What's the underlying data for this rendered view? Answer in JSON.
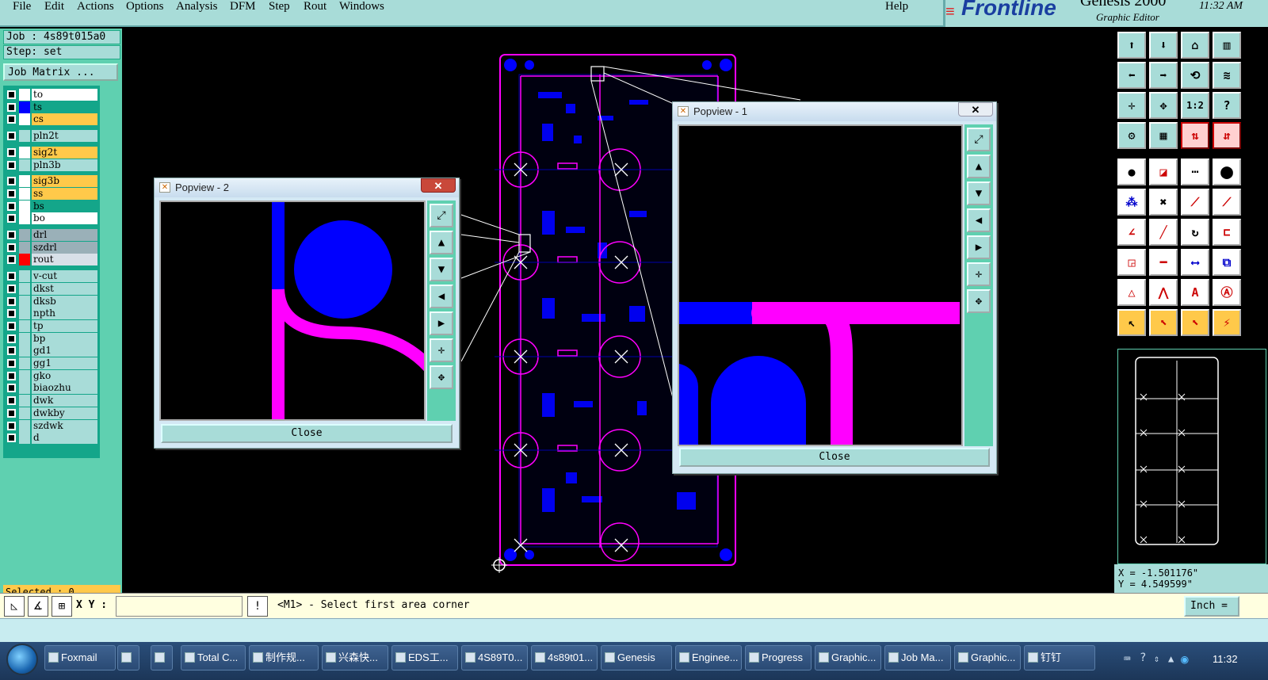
{
  "menu": {
    "items": [
      "File",
      "Edit",
      "Actions",
      "Options",
      "Analysis",
      "DFM",
      "Step",
      "Rout",
      "Windows"
    ],
    "help": "Help"
  },
  "brand": {
    "logo": "Frontline",
    "product": "Genesis 2000",
    "subtitle": "Graphic Editor",
    "time": "11:32 AM"
  },
  "job": {
    "job_line": "Job : 4s89t015a0",
    "step_line": "Step: set",
    "matrix_button": "Job Matrix ..."
  },
  "layers": [
    {
      "name": "to",
      "swatch": "#ffffff",
      "bg": "#ffffff"
    },
    {
      "name": "ts",
      "swatch": "#0000ff",
      "bg": "#14a68a"
    },
    {
      "name": "cs",
      "swatch": "#ffffff",
      "bg": "#ffc94a"
    },
    {
      "name": "pln2t",
      "swatch": "#a8dcd8",
      "bg": "#a8dcd8"
    },
    {
      "name": "sig2t",
      "swatch": "#ffffff",
      "bg": "#ffc94a"
    },
    {
      "name": "pln3b",
      "swatch": "#a8dcd8",
      "bg": "#a8dcd8"
    },
    {
      "name": "sig3b",
      "swatch": "#ffffff",
      "bg": "#ffc94a"
    },
    {
      "name": "ss",
      "swatch": "#ffffff",
      "bg": "#ffc94a"
    },
    {
      "name": "bs",
      "swatch": "#ffffff",
      "bg": "#14a68a"
    },
    {
      "name": "bo",
      "swatch": "#ffffff",
      "bg": "#ffffff"
    },
    {
      "name": "drl",
      "swatch": "#9ab0b8",
      "bg": "#9ab0b8"
    },
    {
      "name": "szdrl",
      "swatch": "#9ab0b8",
      "bg": "#9ab0b8"
    },
    {
      "name": "rout",
      "swatch": "#ff0000",
      "bg": "#d8e0e8"
    },
    {
      "name": "v-cut",
      "swatch": "#a8dcd8",
      "bg": "#a8dcd8"
    },
    {
      "name": "dkst",
      "swatch": "#a8dcd8",
      "bg": "#a8dcd8"
    },
    {
      "name": "dksb",
      "swatch": "#a8dcd8",
      "bg": "#a8dcd8"
    },
    {
      "name": "npth",
      "swatch": "#a8dcd8",
      "bg": "#a8dcd8"
    },
    {
      "name": "tp",
      "swatch": "#a8dcd8",
      "bg": "#a8dcd8"
    },
    {
      "name": "bp",
      "swatch": "#a8dcd8",
      "bg": "#a8dcd8"
    },
    {
      "name": "gd1",
      "swatch": "#a8dcd8",
      "bg": "#a8dcd8"
    },
    {
      "name": "gg1",
      "swatch": "#a8dcd8",
      "bg": "#a8dcd8"
    },
    {
      "name": "gko",
      "swatch": "#a8dcd8",
      "bg": "#a8dcd8"
    },
    {
      "name": "biaozhu",
      "swatch": "#a8dcd8",
      "bg": "#a8dcd8"
    },
    {
      "name": "dwk",
      "swatch": "#a8dcd8",
      "bg": "#a8dcd8"
    },
    {
      "name": "dwkby",
      "swatch": "#a8dcd8",
      "bg": "#a8dcd8"
    },
    {
      "name": "szdwk",
      "swatch": "#a8dcd8",
      "bg": "#a8dcd8"
    },
    {
      "name": "d",
      "swatch": "#a8dcd8",
      "bg": "#a8dcd8"
    }
  ],
  "selected": "Selected : 0",
  "popview1": {
    "title": "Popview - 1",
    "close_label": "Close",
    "x": "✕"
  },
  "popview2": {
    "title": "Popview - 2",
    "close_label": "Close",
    "x": "✕"
  },
  "coords": {
    "x": "X = -1.501176\"",
    "y": "Y =  4.549599\""
  },
  "command": {
    "xy_label": "X Y :",
    "xy_value": "",
    "prompt": "<M1> - Select first area corner",
    "units": "Inch ="
  },
  "taskbar": {
    "tasks": [
      {
        "label": "Foxmail"
      },
      {
        "label": ""
      },
      {
        "label": ""
      },
      {
        "label": "Total C..."
      },
      {
        "label": "制作规..."
      },
      {
        "label": "兴森快..."
      },
      {
        "label": "EDS工..."
      },
      {
        "label": "4S89T0..."
      },
      {
        "label": "4s89t01..."
      },
      {
        "label": "Genesis"
      },
      {
        "label": "Enginee..."
      },
      {
        "label": "Progress"
      },
      {
        "label": "Graphic..."
      },
      {
        "label": "Job Ma..."
      },
      {
        "label": "Graphic..."
      },
      {
        "label": "钉钉"
      }
    ],
    "clock": "11:32"
  },
  "colors": {
    "pad": "#0000ff",
    "rout": "#ff00ff",
    "panel": "#5fd0b0",
    "button": "#a8dcd8"
  }
}
